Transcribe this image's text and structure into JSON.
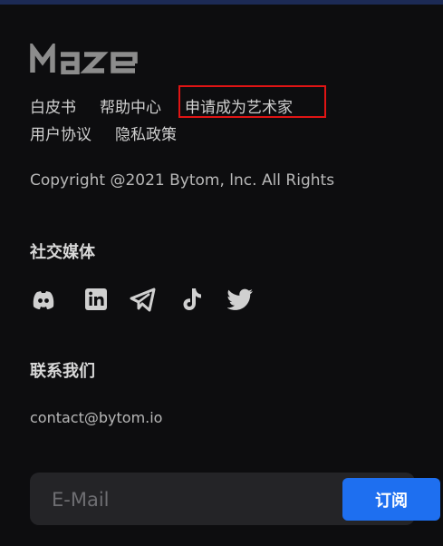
{
  "brand": {
    "logo_text": "Maze"
  },
  "links": {
    "row1": [
      "白皮书",
      "帮助中心",
      "申请成为艺术家"
    ],
    "row2": [
      "用户协议",
      "隐私政策"
    ]
  },
  "copyright": "Copyright @2021 Bytom, lnc. All Rights",
  "social": {
    "title": "社交媒体",
    "icons": [
      "discord-icon",
      "linkedin-icon",
      "telegram-icon",
      "tiktok-icon",
      "twitter-icon"
    ]
  },
  "contact": {
    "title": "联系我们",
    "email": "contact@bytom.io"
  },
  "subscribe": {
    "placeholder": "E-Mail",
    "button_label": "订阅"
  },
  "colors": {
    "background": "#0d0d0f",
    "accent": "#1e6ff0",
    "highlight": "#e01414"
  }
}
